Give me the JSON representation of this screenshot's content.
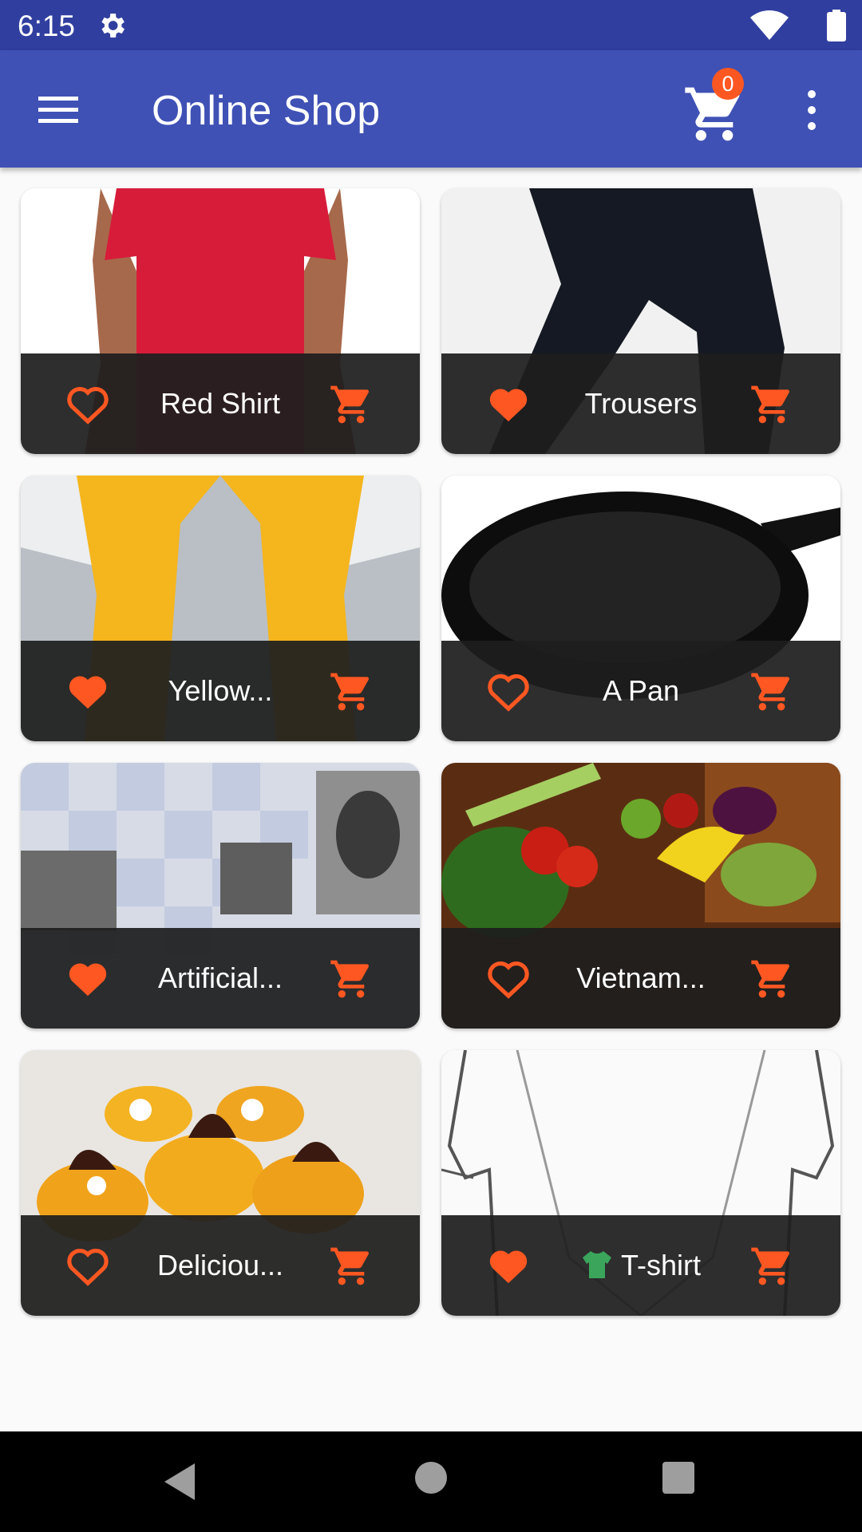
{
  "status_bar": {
    "time": "6:15"
  },
  "app_bar": {
    "title": "Online Shop",
    "cart_count": "0"
  },
  "colors": {
    "primary": "#3f51b5",
    "primary_dark": "#303f9f",
    "accent": "#ff5722"
  },
  "products": [
    {
      "title": "Red Shirt",
      "favorite": false,
      "image": "red-shirt-photo"
    },
    {
      "title": "Trousers",
      "favorite": true,
      "image": "trousers-photo"
    },
    {
      "title": "Yellow...",
      "favorite": true,
      "image": "yellow-scarf-photo"
    },
    {
      "title": "A Pan",
      "favorite": false,
      "image": "pan-photo"
    },
    {
      "title": "Artificial...",
      "favorite": true,
      "image": "ai-collage-photo"
    },
    {
      "title": "Vietnam...",
      "favorite": false,
      "image": "vegetables-photo"
    },
    {
      "title": "Deliciou...",
      "favorite": false,
      "image": "dessert-photo"
    },
    {
      "title": "T-shirt",
      "favorite": true,
      "image": "shirt-sketch",
      "title_icon": "t-shirt-emoji"
    }
  ]
}
